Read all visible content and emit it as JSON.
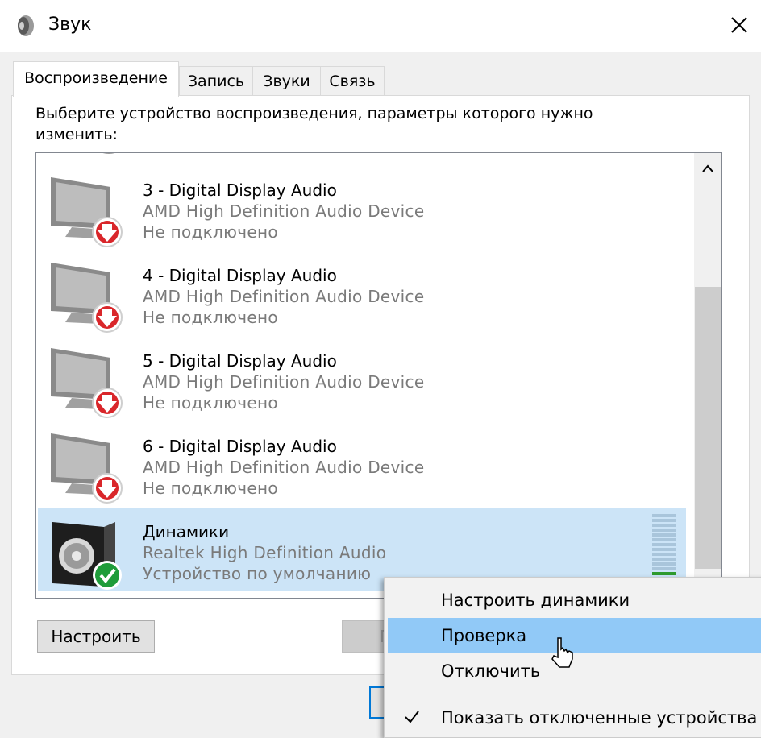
{
  "window": {
    "title": "Звук",
    "icon": "speaker-icon",
    "close_icon": "close-icon"
  },
  "tabs": [
    {
      "label": "Воспроизведение",
      "active": true
    },
    {
      "label": "Запись",
      "active": false
    },
    {
      "label": "Звуки",
      "active": false
    },
    {
      "label": "Связь",
      "active": false
    }
  ],
  "playback": {
    "instruction": "Выберите устройство воспроизведения, параметры которого нужно изменить:",
    "devices": [
      {
        "name": "3 - Digital Display Audio",
        "driver": "AMD High Definition Audio Device",
        "status": "Не подключено",
        "icon": "monitor-disconnected-icon"
      },
      {
        "name": "4 - Digital Display Audio",
        "driver": "AMD High Definition Audio Device",
        "status": "Не подключено",
        "icon": "monitor-disconnected-icon"
      },
      {
        "name": "5 - Digital Display Audio",
        "driver": "AMD High Definition Audio Device",
        "status": "Не подключено",
        "icon": "monitor-disconnected-icon"
      },
      {
        "name": "6 - Digital Display Audio",
        "driver": "AMD High Definition Audio Device",
        "status": "Не подключено",
        "icon": "monitor-disconnected-icon"
      },
      {
        "name": "Динамики",
        "driver": "Realtek High Definition Audio",
        "status": "Устройство по умолчанию",
        "icon": "speaker-default-icon",
        "selected": true
      }
    ]
  },
  "buttons": {
    "configure": "Настроить",
    "default_partial": "П"
  },
  "context_menu": {
    "items": [
      {
        "label": "Настроить динамики"
      },
      {
        "label": "Проверка",
        "hover": true
      },
      {
        "label": "Отключить"
      },
      {
        "label": "Показать отключенные устройства",
        "checked": true
      }
    ]
  },
  "colors": {
    "selection": "#cce4f7",
    "menu_hover": "#91c9f7",
    "meter_on": "#2e9b2e",
    "disconnected_badge": "#d9262a",
    "default_badge": "#1f9c3a"
  }
}
